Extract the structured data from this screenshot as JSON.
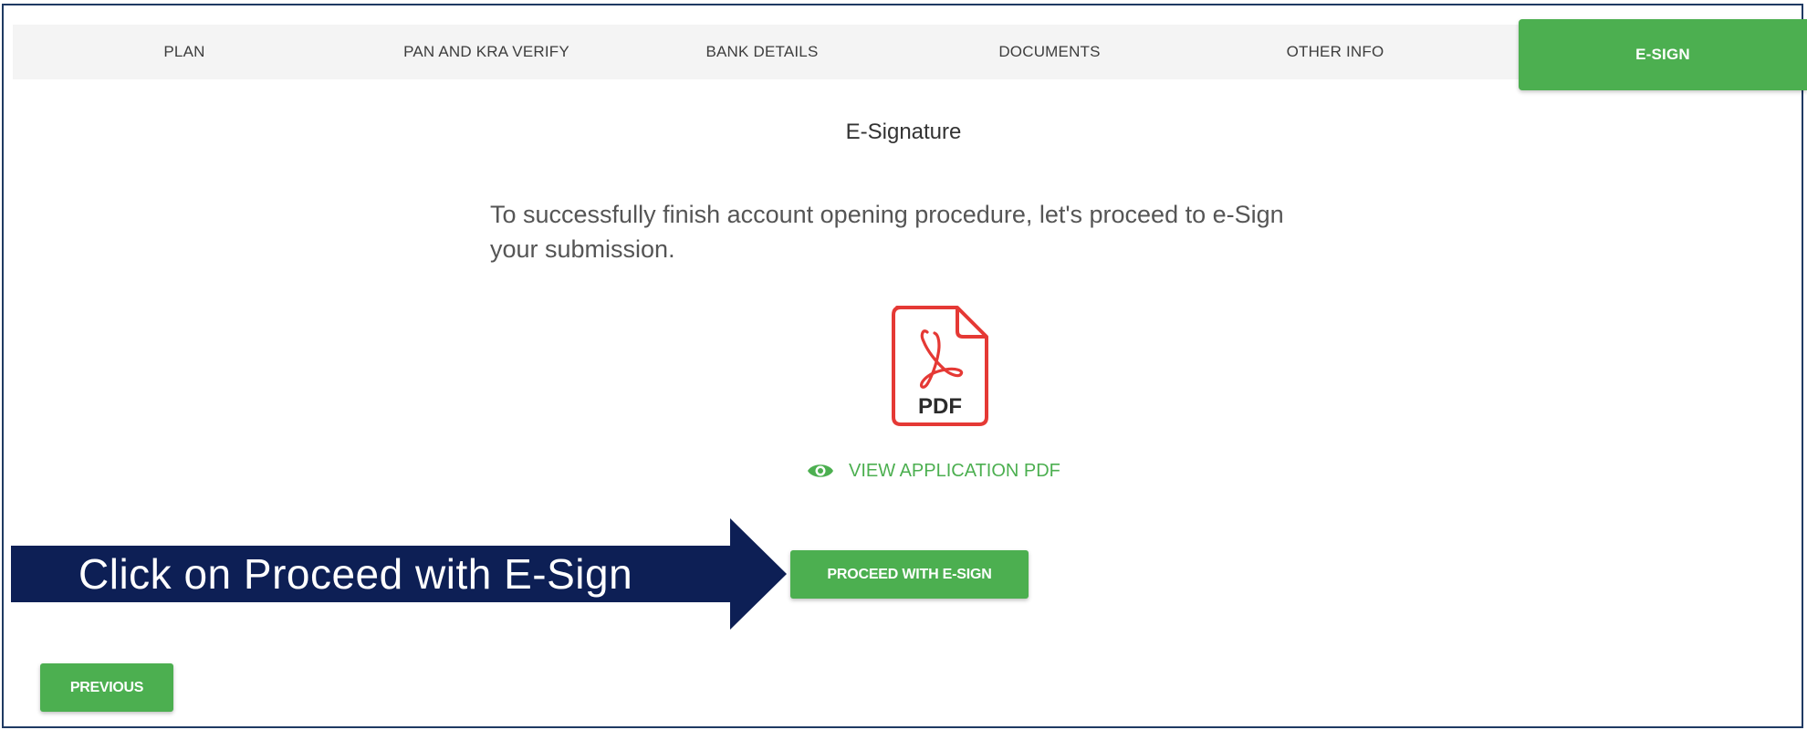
{
  "tabs": [
    {
      "label": "PLAN",
      "active": false
    },
    {
      "label": "PAN AND KRA VERIFY",
      "active": false
    },
    {
      "label": "BANK DETAILS",
      "active": false
    },
    {
      "label": "DOCUMENTS",
      "active": false
    },
    {
      "label": "OTHER INFO",
      "active": false
    },
    {
      "label": "E-SIGN",
      "active": true
    }
  ],
  "main": {
    "title": "E-Signature",
    "instruction": "To successfully finish account opening procedure, let's proceed to e-Sign your submission.",
    "pdf_icon": {
      "name": "pdf-file-icon",
      "label": "PDF"
    },
    "view_link": {
      "icon": "eye-icon",
      "label": "VIEW APPLICATION PDF"
    },
    "proceed_button": "PROCEED WITH E-SIGN",
    "previous_button": "PREVIOUS"
  },
  "annotation": {
    "text": "Click on Proceed with E-Sign",
    "color": "#0d1f55"
  },
  "colors": {
    "accent": "#4caf50",
    "pdf_red": "#e53935",
    "tab_bar": "#f4f4f4",
    "frame_border": "#1f3a63"
  }
}
